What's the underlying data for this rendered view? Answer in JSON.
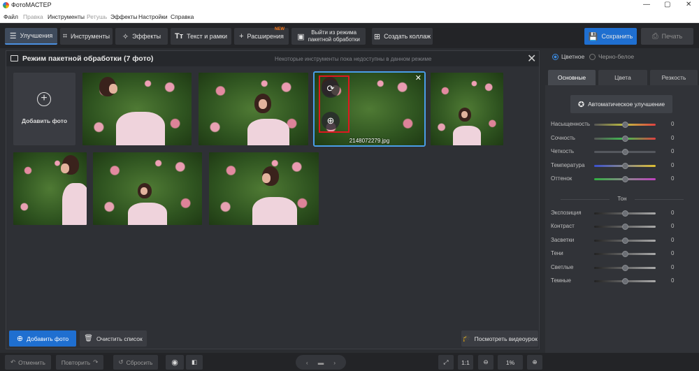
{
  "app": {
    "title": "ФотоМАСТЕР"
  },
  "window_controls": {
    "minimize": "—",
    "maximize": "▢",
    "close": "✕"
  },
  "menu": [
    "Файл",
    "Правка",
    "Инструменты",
    "Ретушь",
    "Эффекты",
    "Настройки",
    "Справка"
  ],
  "menu_disabled": [
    false,
    true,
    false,
    true,
    false,
    false,
    false
  ],
  "toolbar": {
    "enhance": "Улучшения",
    "tools": "Инструменты",
    "effects": "Эффекты",
    "text": "Текст и рамки",
    "extensions": "Расширения",
    "new_badge": "NEW",
    "exit_batch_line1": "Выйти из режима",
    "exit_batch_line2": "пакетной обработки",
    "collage": "Создать коллаж",
    "save": "Сохранить",
    "print": "Печать"
  },
  "panel": {
    "title": "Режим пакетной обработки (7 фото)",
    "note": "Некоторые инструменты пока недоступны в данном режиме",
    "add_tile_label": "Добавить фото",
    "selected_filename": "2148072279.jpg",
    "add_button": "Добавить фото",
    "clear_button": "Очистить список",
    "video_button": "Посмотреть видеоурок"
  },
  "bottom": {
    "undo": "Отменить",
    "redo": "Повторить",
    "reset": "Сбросить",
    "zoom_fit": "1:1",
    "zoom_value": "1%"
  },
  "right": {
    "mode_color": "Цветное",
    "mode_bw": "Черно-белое",
    "tabs": [
      "Основные",
      "Цвета",
      "Резкость"
    ],
    "auto_button": "Автоматическое улучшение",
    "sliders_basic": [
      {
        "label": "Насыщенность",
        "value": "0"
      },
      {
        "label": "Сочность",
        "value": "0"
      },
      {
        "label": "Четкость",
        "value": "0"
      },
      {
        "label": "Температура",
        "value": "0"
      },
      {
        "label": "Оттенок",
        "value": "0"
      }
    ],
    "tone_heading": "Тон",
    "sliders_tone": [
      {
        "label": "Экспозиция",
        "value": "0"
      },
      {
        "label": "Контраст",
        "value": "0"
      },
      {
        "label": "Засветки",
        "value": "0"
      },
      {
        "label": "Тени",
        "value": "0"
      },
      {
        "label": "Светлые",
        "value": "0"
      },
      {
        "label": "Темные",
        "value": "0"
      }
    ]
  },
  "colors": {
    "accent": "#1f6fd0",
    "selection": "#4a9de8",
    "highlight": "#e0171f",
    "new_badge": "#ff7a1a"
  }
}
